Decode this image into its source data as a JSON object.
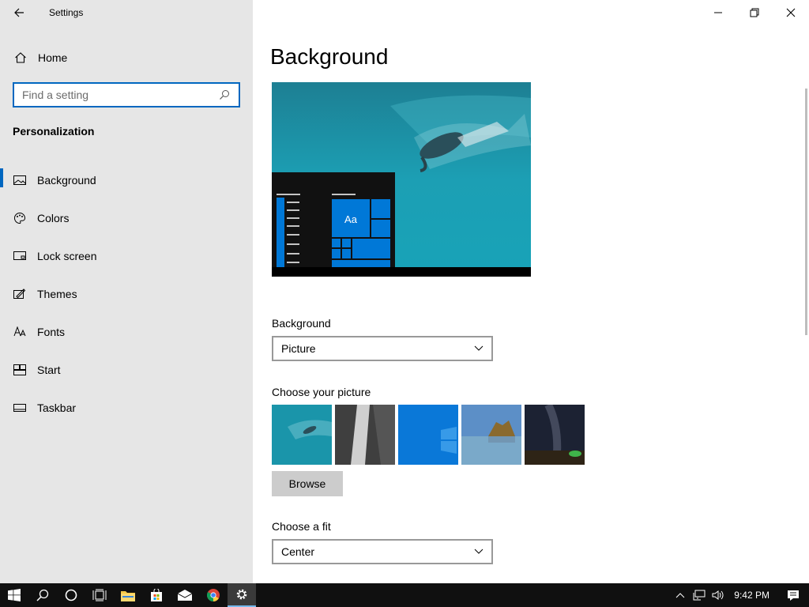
{
  "window": {
    "title": "Settings"
  },
  "sidebar": {
    "home_label": "Home",
    "search_placeholder": "Find a setting",
    "section_title": "Personalization",
    "items": [
      {
        "label": "Background",
        "icon": "picture-icon",
        "active": true
      },
      {
        "label": "Colors",
        "icon": "palette-icon",
        "active": false
      },
      {
        "label": "Lock screen",
        "icon": "lock-screen-icon",
        "active": false
      },
      {
        "label": "Themes",
        "icon": "themes-icon",
        "active": false
      },
      {
        "label": "Fonts",
        "icon": "fonts-icon",
        "active": false
      },
      {
        "label": "Start",
        "icon": "start-icon",
        "active": false
      },
      {
        "label": "Taskbar",
        "icon": "taskbar-icon",
        "active": false
      }
    ]
  },
  "main": {
    "page_title": "Background",
    "preview_sample_text": "Aa",
    "background_label": "Background",
    "background_value": "Picture",
    "choose_picture_label": "Choose your picture",
    "browse_label": "Browse",
    "fit_label": "Choose a fit",
    "fit_value": "Center"
  },
  "taskbar": {
    "clock": "9:42 PM"
  },
  "colors": {
    "accent": "#0067c0",
    "sidebar_bg": "#e6e6e6",
    "taskbar_bg": "#101010",
    "tile_blue": "#0078d7"
  }
}
